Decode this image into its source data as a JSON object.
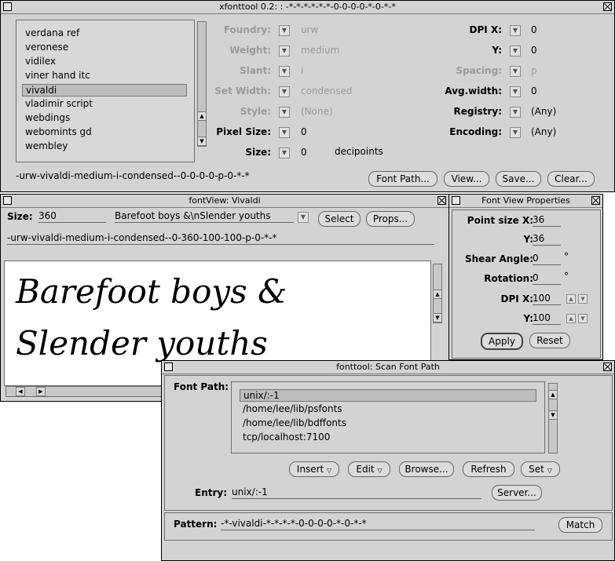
{
  "main_window": {
    "title": "xfonttool 0.2: : -*-*-*-*-*-*-0-0-0-0-*-0-*-*",
    "font_list": [
      "verdana ref",
      "veronese",
      "vidilex",
      "viner hand itc",
      "vivaldi",
      "vladimir script",
      "webdings",
      "webomints gd",
      "wembley"
    ],
    "selected_font": "vivaldi",
    "fields_left": [
      {
        "label": "Foundry:",
        "value": "urw",
        "enabled": false
      },
      {
        "label": "Weight:",
        "value": "medium",
        "enabled": false
      },
      {
        "label": "Slant:",
        "value": "i",
        "enabled": false
      },
      {
        "label": "Set Width:",
        "value": "condensed",
        "enabled": false
      },
      {
        "label": "Style:",
        "value": "(None)",
        "enabled": false
      },
      {
        "label": "Pixel Size:",
        "value": "0",
        "enabled": true
      },
      {
        "label": "Size:",
        "value": "0",
        "enabled": true,
        "unit": "decipoints"
      }
    ],
    "fields_right": [
      {
        "label": "DPI X:",
        "value": "0",
        "enabled": true
      },
      {
        "label": "Y:",
        "value": "0",
        "enabled": true
      },
      {
        "label": "Spacing:",
        "value": "p",
        "enabled": false
      },
      {
        "label": "Avg.width:",
        "value": "0",
        "enabled": true
      },
      {
        "label": "Registry:",
        "value": "(Any)",
        "enabled": true
      },
      {
        "label": "Encoding:",
        "value": "(Any)",
        "enabled": true
      }
    ],
    "xlfd": "-urw-vivaldi-medium-i-condensed--0-0-0-0-p-0-*-*",
    "buttons": [
      "Font Path...",
      "View...",
      "Save...",
      "Clear..."
    ]
  },
  "font_view": {
    "title": "fontView: Vivaldi",
    "size_label": "Size:",
    "size_value": "360",
    "sample_text": "Barefoot boys &\\nSlender youths",
    "select_label": "Select",
    "props_label": "Props...",
    "xlfd": "-urw-vivaldi-medium-i-condensed--0-360-100-100-p-0-*-*",
    "preview_lines": [
      "Barefoot boys &",
      "Slender youths"
    ]
  },
  "props": {
    "title": "Font View Properties",
    "point_size_x_label": "Point size X:",
    "point_size_x": "36",
    "y_label": "Y:",
    "y_value": "36",
    "shear_label": "Shear Angle:",
    "shear_value": "0",
    "rotation_label": "Rotation:",
    "rotation_value": "0",
    "degree": "°",
    "dpi_x_label": "DPI X:",
    "dpi_x": "100",
    "dpi_y_label": "Y:",
    "dpi_y": "100",
    "apply_label": "Apply",
    "reset_label": "Reset"
  },
  "scan": {
    "title": "fonttool: Scan Font Path",
    "font_path_label": "Font Path:",
    "paths": [
      "unix/:-1",
      "/home/lee/lib/psfonts",
      "/home/lee/lib/bdffonts",
      "tcp/localhost:7100"
    ],
    "selected_path": "unix/:-1",
    "buttons": [
      "Insert",
      "Edit",
      "Browse...",
      "Refresh",
      "Set"
    ],
    "entry_label": "Entry:",
    "entry_value": "unix/:-1",
    "server_label": "Server...",
    "pattern_label": "Pattern:",
    "pattern_value": "-*-vivaldi-*-*-*-*-0-0-0-0-*-0-*-*",
    "match_label": "Match"
  }
}
